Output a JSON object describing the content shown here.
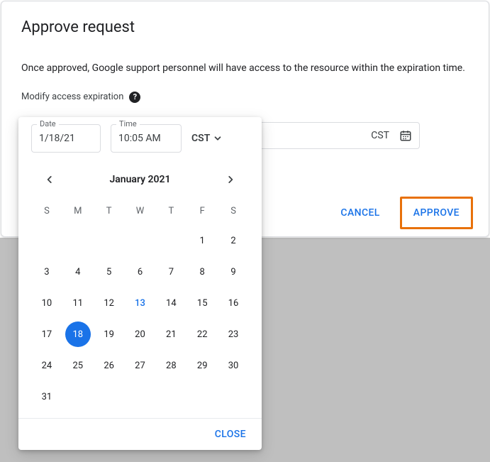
{
  "dialog": {
    "title": "Approve request",
    "description": "Once approved, Google support personnel will have access to the resource within the expiration time.",
    "modify_label": "Modify access expiration",
    "tz_display": "CST",
    "cancel_label": "CANCEL",
    "approve_label": "APPROVE"
  },
  "picker": {
    "date_label": "Date",
    "date_value": "1/18/21",
    "time_label": "Time",
    "time_value": "10:05 AM",
    "tz": "CST",
    "month_title": "January 2021",
    "dow": [
      "S",
      "M",
      "T",
      "W",
      "T",
      "F",
      "S"
    ],
    "leading_blanks": 5,
    "days_in_month": 31,
    "today": 13,
    "selected": 18,
    "close_label": "CLOSE"
  }
}
